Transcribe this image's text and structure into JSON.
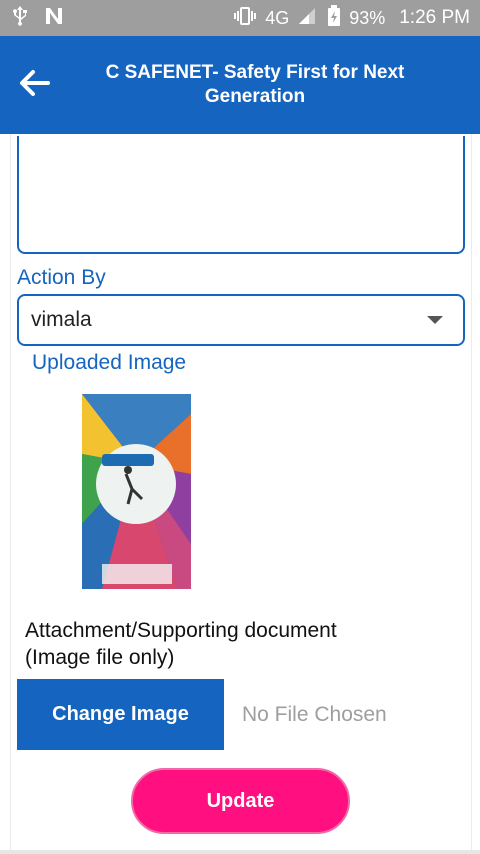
{
  "status_bar": {
    "usb_icon": "usb-icon",
    "n_icon": "notification-n-icon",
    "vibrate_icon": "vibrate-icon",
    "network_type": "4G",
    "signal_icon": "signal-icon",
    "battery_icon": "battery-charging-icon",
    "battery_percent": "93%",
    "time": "1:26 PM"
  },
  "app_bar": {
    "title": "C SAFENET- Safety First for Next Generation",
    "back_icon": "arrow-back-icon",
    "color": "#1565c0"
  },
  "form": {
    "action_by_label": "Action By",
    "action_by_value": "vimala",
    "uploaded_image_label": "Uploaded Image",
    "attachment_label": "Attachment/Supporting document (Image file only)",
    "change_image_label": "Change Image",
    "no_file_text": "No File Chosen",
    "update_label": "Update"
  },
  "colors": {
    "primary": "#1565c0",
    "accent": "#ff0f7f"
  }
}
